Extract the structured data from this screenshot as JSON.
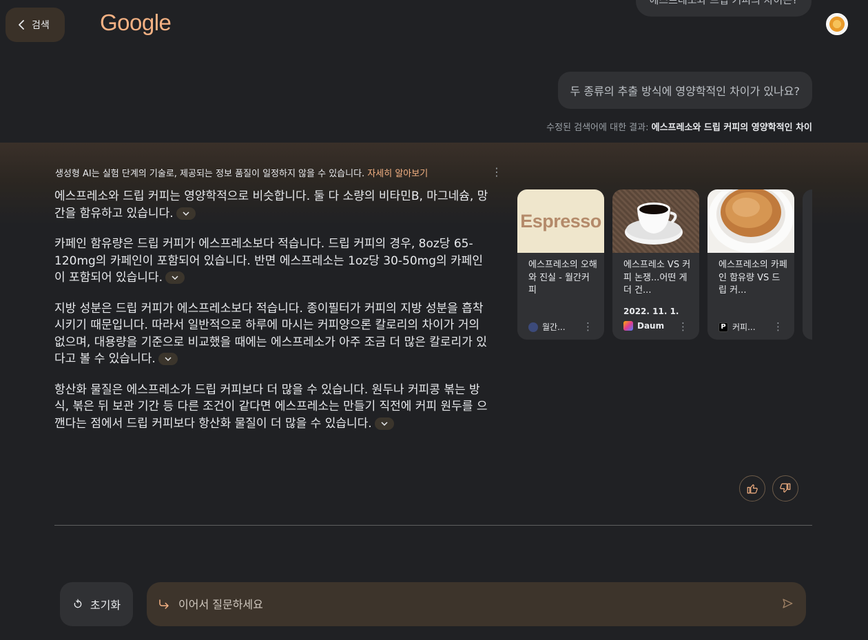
{
  "header": {
    "back_label": "검색",
    "logo": "Google",
    "prev_query": "에스프레소와 드립 커피의 차이는?"
  },
  "conversation": {
    "query": "두 종류의 추출 방식에 영양학적인 차이가 있나요?",
    "revised_prefix": "수정된 검색어에 대한 결과: ",
    "revised_query": "에스프레소와 드립 커피의 영양학적인 차이"
  },
  "ai_overview": {
    "disclaimer": "생성형 AI는 실험 단계의 기술로, 제공되는 정보 품질이 일정하지 않을 수 있습니다.",
    "learn_more": "자세히 알아보기",
    "paragraphs": [
      "에스프레소와 드립 커피는 영양학적으로 비슷합니다. 둘 다 소량의 비타민B, 마그네슘, 망간을 함유하고 있습니다.",
      "카페인 함유량은 드립 커피가 에스프레소보다 적습니다. 드립 커피의 경우, 8oz당 65-120mg의 카페인이 포함되어 있습니다. 반면 에스프레소는 1oz당 30-50mg의 카페인이 포함되어 있습니다.",
      "지방 성분은 드립 커피가 에스프레소보다 적습니다. 종이필터가 커피의 지방 성분을 흡착시키기 때문입니다. 따라서 일반적으로 하루에 마시는 커피양으론 칼로리의 차이가 거의 없으며, 대용량을 기준으로 비교했을 때에는 에스프레소가 아주 조금 더 많은 칼로리가 있다고 볼 수 있습니다.",
      "항산화 물질은 에스프레소가 드립 커피보다 더 많을 수 있습니다. 원두나 커피콩 볶는 방식, 볶은 뒤 보관 기간 등 다른 조건이 같다면 에스프레소는 만들기 직전에 커피 원두를 으깬다는 점에서 드립 커피보다 항산화 물질이 더 많을 수 있습니다."
    ]
  },
  "sources": [
    {
      "thumb_text": "Espresso",
      "title": "에스프레소의 오해와 진실 - 월간커피",
      "date": "",
      "site": "월간...",
      "favicon_color": "#3c4a7a"
    },
    {
      "thumb_text": "",
      "title": "에스프레소 VS 커피 논쟁...어떤 게 더 건...",
      "date": "2022. 11. 1.",
      "site": "Daum",
      "favicon_color": "#ffb000"
    },
    {
      "thumb_text": "",
      "title": "에스프레소의 카페인 함유량 VS 드립 커...",
      "date": "",
      "site": "커피...",
      "favicon_color": "#000000"
    }
  ],
  "footer": {
    "reset_label": "초기화",
    "ask_placeholder": "이어서 질문하세요"
  },
  "colors": {
    "accent": "#f4b183",
    "background": "#202124",
    "bubble": "#303134"
  }
}
